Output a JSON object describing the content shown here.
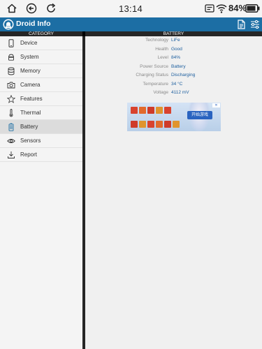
{
  "status_bar": {
    "time": "13:14",
    "battery": "84%"
  },
  "app_bar": {
    "title": "Droid Info",
    "icons": [
      "document-icon",
      "sliders-icon"
    ]
  },
  "column_headers": {
    "left": "CATEGORY",
    "right": "BATTERY"
  },
  "sidebar": {
    "items": [
      {
        "label": "Device",
        "icon": "phone-icon",
        "active": false
      },
      {
        "label": "System",
        "icon": "android-icon",
        "active": false
      },
      {
        "label": "Memory",
        "icon": "database-icon",
        "active": false
      },
      {
        "label": "Camera",
        "icon": "camera-icon",
        "active": false
      },
      {
        "label": "Features",
        "icon": "star-icon",
        "active": false
      },
      {
        "label": "Thermal",
        "icon": "thermometer-icon",
        "active": false
      },
      {
        "label": "Battery",
        "icon": "battery-icon",
        "active": true
      },
      {
        "label": "Sensors",
        "icon": "eye-icon",
        "active": false
      },
      {
        "label": "Report",
        "icon": "download-icon",
        "active": false
      }
    ]
  },
  "battery": {
    "rows": [
      {
        "label": "Technology",
        "value": "LiFe"
      },
      {
        "label": "Health",
        "value": "Good"
      },
      {
        "label": "Level",
        "value": "84%"
      },
      {
        "label": "Power Source",
        "value": "Battery"
      },
      {
        "label": "Charging Status",
        "value": "Discharging"
      },
      {
        "label": "Temperature",
        "value": "34 °C"
      },
      {
        "label": "Voltage",
        "value": "4112 mV"
      }
    ]
  },
  "ad": {
    "button": "开始游戏",
    "close": "✕"
  },
  "colors": {
    "app_bar": "#1c6ea4",
    "value_text": "#1c5e9e",
    "header_bar": "#262626"
  }
}
